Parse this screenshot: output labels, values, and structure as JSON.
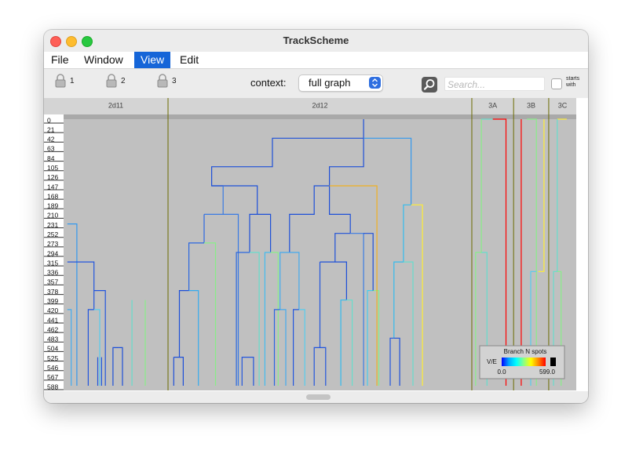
{
  "window": {
    "title": "TrackScheme"
  },
  "menu": [
    "File",
    "Window",
    "View",
    "Edit"
  ],
  "menu_active": "View",
  "toolbar": {
    "locks": [
      "1",
      "2",
      "3"
    ],
    "context_label": "context:",
    "context_value": "full graph",
    "search_placeholder": "Search...",
    "starts_with_line1": "starts",
    "starts_with_line2": "with"
  },
  "columns": [
    {
      "label": "2d11",
      "from": 0,
      "to": 5.5
    },
    {
      "label": "2d12",
      "from": 5.5,
      "to": 21.5
    },
    {
      "label": "3A",
      "from": 21.5,
      "to": 23.7
    },
    {
      "label": "3B",
      "from": 23.7,
      "to": 25.55
    },
    {
      "label": "3C",
      "from": 25.55,
      "to": 27
    }
  ],
  "time_ticks": [
    "0",
    "21",
    "42",
    "63",
    "84",
    "105",
    "126",
    "147",
    "168",
    "189",
    "210",
    "231",
    "252",
    "273",
    "294",
    "315",
    "336",
    "357",
    "378",
    "399",
    "420",
    "441",
    "462",
    "483",
    "504",
    "525",
    "546",
    "567",
    "588"
  ],
  "legend": {
    "title": "Branch N spots",
    "axis_label": "V/E",
    "min": "0.0",
    "max": "599.0",
    "colors": [
      "#0000ff",
      "#00aaff",
      "#00ffff",
      "#88ff88",
      "#ffff00",
      "#ff8800",
      "#ff0000",
      "#000000"
    ]
  },
  "tree_branches": [
    {
      "t0": 0,
      "t1": 588,
      "x0": 0.22,
      "x1": 0.22,
      "color": "#2266ee",
      "parent": null
    },
    {
      "t0": 231,
      "t1": 588,
      "x0": 0.1,
      "x1": 0.8,
      "color": "#3399ee",
      "parent": null
    },
    {
      "t0": 315,
      "t1": 588,
      "x0": 0.8,
      "x1": 1.6,
      "color": "#44aaee",
      "parent": null
    },
    {
      "t0": 420,
      "t1": 588,
      "x0": 1.6,
      "x1": 2.3,
      "color": "#55ccee",
      "parent": null
    },
    {
      "t0": 504,
      "t1": 588,
      "x0": 2.7,
      "x1": 3.4,
      "color": "#2255dd",
      "parent": null
    },
    {
      "t0": 399,
      "t1": 588,
      "x0": 3.8,
      "x1": 4.4,
      "color": "#77ddcc",
      "parent": null
    },
    {
      "t0": 0,
      "t1": 588,
      "x0": 5.5,
      "x1": 5.5,
      "color": "#777700",
      "parent": null
    },
    {
      "t0": 0,
      "t1": 42,
      "x0": 15.8,
      "x1": 15.8,
      "color": "#1d4fd8",
      "parent": null
    },
    {
      "t0": 42,
      "t1": 105,
      "x0": 12.8,
      "x1": 15.8,
      "color": "#1d4fd8",
      "parent": null
    },
    {
      "t0": 105,
      "t1": 147,
      "x0": 7.8,
      "x1": 11.0,
      "color": "#1d4fd8",
      "parent": null
    },
    {
      "t0": 105,
      "t1": 147,
      "x0": 14.0,
      "x1": 15.8,
      "color": "#1d4fd8",
      "parent": null
    },
    {
      "t0": 147,
      "t1": 210,
      "x0": 8.4,
      "x1": 11.0,
      "color": "#3a7be3",
      "parent": null
    },
    {
      "t0": 147,
      "t1": 189,
      "x0": 14.0,
      "x1": 16.5,
      "color": "#f0b020",
      "parent": null
    },
    {
      "t0": 189,
      "t1": 588,
      "x0": 17.9,
      "x1": 18.9,
      "color": "#33bbee",
      "parent": null
    },
    {
      "t0": 0,
      "t1": 588,
      "x0": 21.5,
      "x1": 21.5,
      "color": "#777700",
      "parent": null
    },
    {
      "t0": 0,
      "t1": 588,
      "x0": 23.7,
      "x1": 23.7,
      "color": "#777700",
      "parent": null
    },
    {
      "t0": 0,
      "t1": 588,
      "x0": 25.55,
      "x1": 25.55,
      "color": "#777700",
      "parent": null
    }
  ],
  "tree_segments": [
    [
      "#1d4fd8",
      [
        [
          15.8,
          0
        ],
        [
          15.8,
          42
        ],
        [
          11.0,
          42
        ],
        [
          11.0,
          105
        ],
        [
          7.8,
          105
        ],
        [
          7.8,
          147
        ],
        [
          8.4,
          147
        ]
      ]
    ],
    [
      "#1d4fd8",
      [
        [
          15.8,
          42
        ],
        [
          15.8,
          105
        ],
        [
          14.0,
          105
        ],
        [
          14.0,
          147
        ]
      ]
    ],
    [
      "#3399ee",
      [
        [
          15.8,
          42
        ],
        [
          18.3,
          42
        ],
        [
          18.3,
          189
        ]
      ]
    ],
    [
      "#1d4fd8",
      [
        [
          7.8,
          147
        ],
        [
          10.2,
          147
        ],
        [
          10.2,
          210
        ]
      ]
    ],
    [
      "#3a7be3",
      [
        [
          8.4,
          147
        ],
        [
          8.4,
          210
        ],
        [
          7.4,
          210
        ]
      ]
    ],
    [
      "#3a7be3",
      [
        [
          8.4,
          210
        ],
        [
          9.2,
          210
        ],
        [
          9.2,
          588
        ]
      ]
    ],
    [
      "#2a66e0",
      [
        [
          7.4,
          210
        ],
        [
          7.4,
          273
        ],
        [
          6.6,
          273
        ],
        [
          6.6,
          378
        ]
      ]
    ],
    [
      "#88ee88",
      [
        [
          7.4,
          273
        ],
        [
          8.0,
          273
        ],
        [
          8.0,
          588
        ]
      ]
    ],
    [
      "#1d4fd8",
      [
        [
          10.2,
          210
        ],
        [
          9.8,
          210
        ],
        [
          9.8,
          294
        ]
      ]
    ],
    [
      "#1d4fd8",
      [
        [
          10.2,
          210
        ],
        [
          10.9,
          210
        ],
        [
          10.9,
          294
        ]
      ]
    ],
    [
      "#2a66e0",
      [
        [
          9.8,
          294
        ],
        [
          9.1,
          294
        ],
        [
          9.1,
          588
        ]
      ]
    ],
    [
      "#66ddcc",
      [
        [
          9.8,
          294
        ],
        [
          10.3,
          294
        ],
        [
          10.3,
          588
        ]
      ]
    ],
    [
      "#44bbee",
      [
        [
          10.9,
          294
        ],
        [
          10.6,
          294
        ],
        [
          10.6,
          588
        ]
      ]
    ],
    [
      "#88ee88",
      [
        [
          10.9,
          294
        ],
        [
          11.3,
          294
        ],
        [
          11.3,
          588
        ]
      ]
    ],
    [
      "#1d4fd8",
      [
        [
          6.6,
          378
        ],
        [
          6.1,
          378
        ],
        [
          6.1,
          525
        ],
        [
          5.8,
          525
        ]
      ]
    ],
    [
      "#33aaee",
      [
        [
          6.6,
          378
        ],
        [
          7.1,
          378
        ],
        [
          7.1,
          588
        ]
      ]
    ],
    [
      "#1d4fd8",
      [
        [
          5.8,
          525
        ],
        [
          5.8,
          588
        ]
      ]
    ],
    [
      "#1d4fd8",
      [
        [
          6.1,
          525
        ],
        [
          6.3,
          525
        ],
        [
          6.3,
          588
        ]
      ]
    ],
    [
      "#2255dd",
      [
        [
          9.8,
          525
        ],
        [
          9.4,
          525
        ],
        [
          9.4,
          588
        ]
      ]
    ],
    [
      "#2255dd",
      [
        [
          9.8,
          525
        ],
        [
          10.0,
          525
        ],
        [
          10.0,
          588
        ]
      ]
    ],
    [
      "#1d4fd8",
      [
        [
          14.0,
          147
        ],
        [
          13.2,
          147
        ],
        [
          13.2,
          210
        ],
        [
          11.9,
          210
        ],
        [
          11.9,
          294
        ]
      ]
    ],
    [
      "#1d4fd8",
      [
        [
          14.0,
          147
        ],
        [
          14.0,
          210
        ],
        [
          15.1,
          210
        ],
        [
          15.1,
          252
        ]
      ]
    ],
    [
      "#44aaee",
      [
        [
          11.9,
          294
        ],
        [
          11.4,
          294
        ],
        [
          11.4,
          420
        ]
      ]
    ],
    [
      "#44aaee",
      [
        [
          11.9,
          294
        ],
        [
          12.4,
          294
        ],
        [
          12.4,
          420
        ]
      ]
    ],
    [
      "#2a66e0",
      [
        [
          11.4,
          420
        ],
        [
          11.1,
          420
        ],
        [
          11.1,
          588
        ]
      ]
    ],
    [
      "#44aaee",
      [
        [
          11.4,
          420
        ],
        [
          11.7,
          420
        ],
        [
          11.7,
          588
        ]
      ]
    ],
    [
      "#2255dd",
      [
        [
          12.4,
          420
        ],
        [
          12.1,
          420
        ],
        [
          12.1,
          588
        ]
      ]
    ],
    [
      "#55ccee",
      [
        [
          12.4,
          420
        ],
        [
          12.7,
          420
        ],
        [
          12.7,
          588
        ]
      ]
    ],
    [
      "#1d4fd8",
      [
        [
          15.1,
          252
        ],
        [
          14.3,
          252
        ],
        [
          14.3,
          315
        ],
        [
          13.5,
          315
        ]
      ]
    ],
    [
      "#3a7be3",
      [
        [
          15.1,
          252
        ],
        [
          15.8,
          252
        ],
        [
          15.8,
          588
        ]
      ]
    ],
    [
      "#1d4fd8",
      [
        [
          14.3,
          315
        ],
        [
          14.9,
          315
        ],
        [
          14.9,
          399
        ]
      ]
    ],
    [
      "#2255dd",
      [
        [
          13.5,
          315
        ],
        [
          13.5,
          504
        ],
        [
          13.2,
          504
        ],
        [
          13.2,
          588
        ]
      ]
    ],
    [
      "#2255dd",
      [
        [
          13.5,
          504
        ],
        [
          13.8,
          504
        ],
        [
          13.8,
          588
        ]
      ]
    ],
    [
      "#33bbee",
      [
        [
          14.9,
          399
        ],
        [
          14.6,
          399
        ],
        [
          14.6,
          588
        ]
      ]
    ],
    [
      "#66ddcc",
      [
        [
          14.9,
          399
        ],
        [
          15.2,
          399
        ],
        [
          15.2,
          588
        ]
      ]
    ],
    [
      "#44ccee",
      [
        [
          16.3,
          378
        ],
        [
          16.0,
          378
        ],
        [
          16.0,
          588
        ]
      ]
    ],
    [
      "#88ee88",
      [
        [
          16.3,
          378
        ],
        [
          16.6,
          378
        ],
        [
          16.6,
          588
        ]
      ]
    ],
    [
      "#1d4fd8",
      [
        [
          15.8,
          252
        ],
        [
          16.3,
          252
        ],
        [
          16.3,
          378
        ]
      ]
    ],
    [
      "#f0b020",
      [
        [
          14.0,
          147
        ],
        [
          16.5,
          147
        ],
        [
          16.5,
          588
        ]
      ]
    ],
    [
      "#33bbee",
      [
        [
          18.3,
          189
        ],
        [
          17.9,
          189
        ],
        [
          17.9,
          315
        ],
        [
          17.4,
          315
        ],
        [
          17.4,
          483
        ]
      ]
    ],
    [
      "#ffee33",
      [
        [
          18.3,
          189
        ],
        [
          18.9,
          189
        ],
        [
          18.9,
          588
        ]
      ]
    ],
    [
      "#1d4fd8",
      [
        [
          17.4,
          483
        ],
        [
          17.7,
          483
        ],
        [
          17.7,
          588
        ]
      ]
    ],
    [
      "#66ddcc",
      [
        [
          17.9,
          315
        ],
        [
          18.4,
          315
        ],
        [
          18.4,
          588
        ]
      ]
    ],
    [
      "#2255dd",
      [
        [
          17.4,
          483
        ],
        [
          17.2,
          483
        ],
        [
          17.2,
          588
        ]
      ]
    ],
    [
      "#88ee88",
      [
        [
          22.0,
          0
        ],
        [
          22.0,
          294
        ],
        [
          21.7,
          294
        ],
        [
          21.7,
          588
        ]
      ]
    ],
    [
      "#66ddcc",
      [
        [
          22.0,
          294
        ],
        [
          22.3,
          294
        ],
        [
          22.3,
          588
        ]
      ]
    ],
    [
      "#ff0000",
      [
        [
          22.6,
          0
        ],
        [
          23.3,
          0
        ],
        [
          23.3,
          588
        ]
      ]
    ],
    [
      "#66ddcc",
      [
        [
          22.0,
          0
        ],
        [
          22.6,
          0
        ]
      ]
    ],
    [
      "#ff0000",
      [
        [
          24.1,
          0
        ],
        [
          24.1,
          588
        ]
      ]
    ],
    [
      "#88ee88",
      [
        [
          24.4,
          0
        ],
        [
          24.9,
          0
        ],
        [
          24.9,
          588
        ]
      ]
    ],
    [
      "#55ccee",
      [
        [
          24.9,
          336
        ],
        [
          24.6,
          336
        ],
        [
          24.6,
          588
        ]
      ]
    ],
    [
      "#ffee33",
      [
        [
          25.3,
          0
        ],
        [
          25.3,
          336
        ],
        [
          25.0,
          336
        ]
      ]
    ],
    [
      "#ffee33",
      [
        [
          26.0,
          0
        ],
        [
          26.5,
          0
        ]
      ]
    ],
    [
      "#66ddcc",
      [
        [
          26.0,
          0
        ],
        [
          26.0,
          336
        ],
        [
          25.8,
          336
        ],
        [
          25.8,
          588
        ]
      ]
    ],
    [
      "#88ee88",
      [
        [
          26.0,
          336
        ],
        [
          26.2,
          336
        ],
        [
          26.2,
          588
        ]
      ]
    ],
    [
      "#3399ee",
      [
        [
          0.2,
          231
        ],
        [
          0.7,
          231
        ],
        [
          0.7,
          588
        ]
      ]
    ],
    [
      "#2255dd",
      [
        [
          0.2,
          315
        ],
        [
          1.6,
          315
        ],
        [
          1.6,
          420
        ],
        [
          1.3,
          420
        ],
        [
          1.3,
          588
        ]
      ]
    ],
    [
      "#55ccee",
      [
        [
          1.6,
          420
        ],
        [
          1.9,
          420
        ],
        [
          1.9,
          588
        ]
      ]
    ],
    [
      "#2255dd",
      [
        [
          1.6,
          378
        ],
        [
          2.2,
          378
        ],
        [
          2.2,
          588
        ]
      ]
    ],
    [
      "#44aaee",
      [
        [
          0.2,
          420
        ],
        [
          0.4,
          420
        ],
        [
          0.4,
          588
        ]
      ]
    ],
    [
      "#1d4fd8",
      [
        [
          2.9,
          504
        ],
        [
          2.6,
          504
        ],
        [
          2.6,
          588
        ]
      ]
    ],
    [
      "#1d4fd8",
      [
        [
          2.9,
          504
        ],
        [
          3.1,
          504
        ],
        [
          3.1,
          588
        ]
      ]
    ],
    [
      "#66ddcc",
      [
        [
          3.6,
          399
        ],
        [
          3.6,
          588
        ]
      ]
    ],
    [
      "#88ee88",
      [
        [
          4.3,
          399
        ],
        [
          4.3,
          588
        ]
      ]
    ],
    [
      "#2255dd",
      [
        [
          1.8,
          525
        ],
        [
          1.8,
          588
        ]
      ]
    ],
    [
      "#2255dd",
      [
        [
          2.0,
          525
        ],
        [
          2.0,
          588
        ]
      ]
    ]
  ]
}
